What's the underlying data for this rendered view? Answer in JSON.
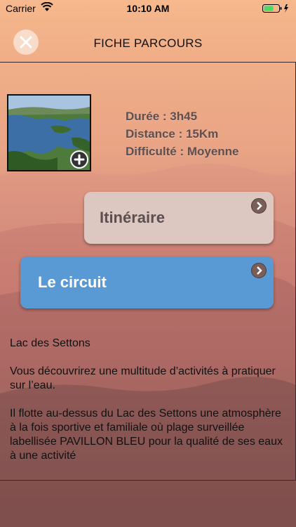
{
  "status_bar": {
    "carrier": "Carrier",
    "time": "10:10 AM"
  },
  "nav": {
    "title": "FICHE PARCOURS",
    "close_icon": "close-icon"
  },
  "parcours": {
    "duree": "Durée : 3h45",
    "distance": "Distance : 15Km",
    "difficulte": "Difficulté : Moyenne"
  },
  "buttons": {
    "itineraire": "Itinéraire",
    "circuit": "Le circuit"
  },
  "description": {
    "title": "Lac des Settons",
    "p1": "Vous découvrirez une multitude d’activités à pratiquer sur l’eau.",
    "p2": "Il flotte au-dessus du Lac des Settons une atmosphère à la fois sportive et familiale où plage surveillée labellisée PAVILLON BLEU pour la qualité de ses eaux à une activité"
  },
  "colors": {
    "button_blue": "#5a9ad4",
    "button_pink": "#dcc7c1",
    "battery": "#4cd964"
  }
}
